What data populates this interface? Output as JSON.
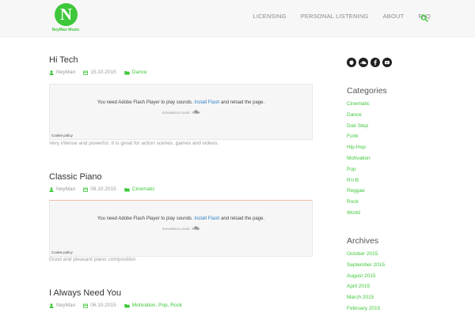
{
  "brand": {
    "logo_letter": "N",
    "logo_text": "NeyMan Music",
    "accent": "#3ec73a"
  },
  "nav": {
    "items": [
      {
        "label": "LICENSING"
      },
      {
        "label": "PERSONAL LISTENING"
      },
      {
        "label": "ABOUT"
      },
      {
        "label": "FAQ"
      }
    ]
  },
  "posts": [
    {
      "title": "Hi Tech",
      "author": "NeyMan",
      "date": "15.10.2015",
      "categories": "Dance",
      "player": {
        "message_before": "You need Adobe Flash Player to play sounds.",
        "link": "Install Flash",
        "message_after": "and reload the page.",
        "brand": "SOUNDCLOUD",
        "cookie": "Cookie policy"
      },
      "excerpt": "Very intense and powerful. It is great for action scenes, games and videos."
    },
    {
      "title": "Classic Piano",
      "author": "NeyMan",
      "date": "08.10.2015",
      "categories": "Cinematic",
      "player": {
        "message_before": "You need Adobe Flash Player to play sounds.",
        "link": "Install Flash",
        "message_after": "and reload the page.",
        "brand": "SOUNDCLOUD",
        "cookie": "Cookie policy"
      },
      "excerpt": "Good and pleasant piano composition."
    },
    {
      "title": "I Always Need You",
      "author": "NeyMan",
      "date": "06.10.2015",
      "categories": "Motivation, Pop, Rock"
    }
  ],
  "social": [
    "apple-icon",
    "soundcloud-icon",
    "facebook-icon",
    "youtube-icon"
  ],
  "sidebar": {
    "categories_title": "Categories",
    "categories": [
      "Cinematic",
      "Dance",
      "Dub Step",
      "Funk",
      "Hip-Hop",
      "Motivation",
      "Pop",
      "R'n'B",
      "Reggae",
      "Rock",
      "World"
    ],
    "archives_title": "Archives",
    "archives": [
      "October 2015",
      "September 2015",
      "August 2015",
      "April 2015",
      "March 2015",
      "February 2015"
    ]
  }
}
